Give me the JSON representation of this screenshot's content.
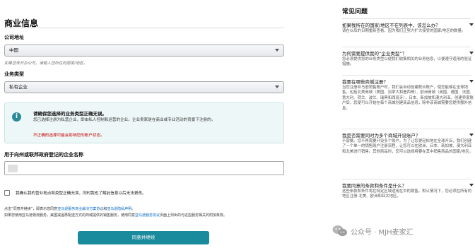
{
  "form": {
    "title": "商业信息",
    "address_label": "公司地址",
    "address_value": "中国",
    "address_hint": "如果您未开办公司，请输入您所在的国家/地区。",
    "business_type_label": "业务类型",
    "business_type_value": "私有企业",
    "alert": {
      "title": "请确保您选择的业务类型正确无误。",
      "body": "您已选择注册为私营企业，即由私人控制和运营的企业。企业卖家是在商业或专业活动的背景下注册的。",
      "warning": "不正确的选择可能会影响您的帐户状态。"
    },
    "name_label": "用于向州或联邦政府登记的企业名称",
    "confirm_text": "我确认我的营业地点和类型正确无误，同时我也了解此信息以后无法更改。",
    "legal": {
      "line1_prefix": "点击“同意并继续”，即表示您同意",
      "line1_link1": "亚马逊服务商业解决方案协议",
      "line1_mid": "和",
      "line1_link2": "亚马逊隐私声明",
      "line1_suffix": "。",
      "line2_prefix": "如果您使用亚马逊物流服务，美国减温再配送方式的商城提供的销售服务，使用同意",
      "line2_link": "亚马逊服务协议",
      "line2_suffix": "页面上列出的与这些服务相关的附加条款。"
    },
    "submit_label": "同意并继续"
  },
  "faq": {
    "title": "常见问题",
    "items": [
      {
        "q": "如果我所在的国家/地区不在列表中，该怎么办？",
        "a": "请在以后的日期重新查看，因为我们正努力扩大接受的国家/地区的数量。"
      },
      {
        "q": "为何需要提供我的“企业类型”？",
        "a": "您必须提供您的业务类型以便我们收集相关的业务信息，以便遵守适用的验证措施。"
      },
      {
        "q": "我要在哪些商城注册？",
        "a": "当您注册亚马逊销售账户时，我们会自动创建联合账户，使您能够在全球销售，包括北美商城（美国、加拿大和墨西哥）、欧洲商城（英国、德国、法国、意大利、荷兰、波兰、瑞典和西班牙），日本、新加坡和澳大利亚。创建卖家账户后，您便可以开始在每个商城创建商品信息，除非该商城需要您提供额外信息。"
      },
      {
        "q": "我是否需要同时为多个商城开设账户？",
        "a": "不需要。您不再需要开设多个账户。为了让您更轻松地在全球开店，我们创建了一个单一的销售账户注册流程，让您可以在欧洲、日本、新加坡、澳大利亚和北美进行销售。其他商品时，您可以选择将要在其中销售商品的国家/地区。"
      },
      {
        "q": "我要同意的条款和条件是什么？",
        "a": "这些条款和条件将在特定区域适用在中的销售。默认情况下，您必须在所有的地区注册-北美、欧洲和亚太地区。"
      }
    ]
  },
  "watermark": {
    "text": "公众号 · MJH麦家汇"
  }
}
